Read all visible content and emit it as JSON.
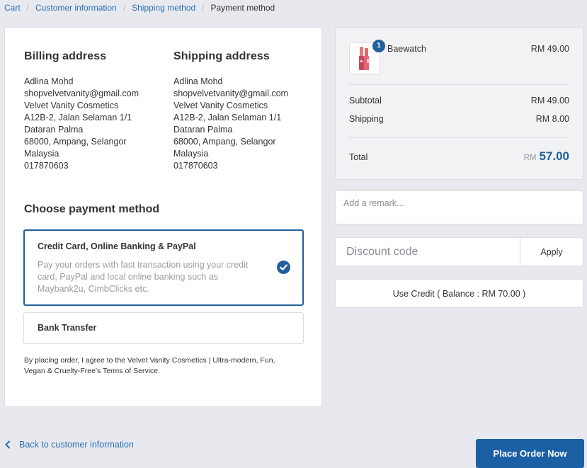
{
  "breadcrumb": {
    "items": [
      "Cart",
      "Customer information",
      "Shipping method"
    ],
    "current": "Payment method"
  },
  "billing": {
    "title": "Billing address",
    "lines": [
      "Adlina Mohd",
      "shopvelvetvanity@gmail.com",
      "Velvet Vanity Cosmetics",
      "A12B-2, Jalan Selaman 1/1",
      "Dataran Palma",
      "68000, Ampang, Selangor",
      "Malaysia",
      "017870603"
    ]
  },
  "shipping": {
    "title": "Shipping address",
    "lines": [
      "Adlina Mohd",
      "shopvelvetvanity@gmail.com",
      "Velvet Vanity Cosmetics",
      "A12B-2, Jalan Selaman 1/1",
      "Dataran Palma",
      "68000, Ampang, Selangor",
      "Malaysia",
      "017870603"
    ]
  },
  "payment": {
    "title": "Choose payment method",
    "options": [
      {
        "name": "Credit Card, Online Banking & PayPal",
        "description": "Pay your orders with fast transaction using your credit card, PayPal and local online banking such as Maybank2u, CimbClicks etc.",
        "selected": true
      },
      {
        "name": "Bank Transfer",
        "selected": false
      }
    ],
    "terms": "By placing order, I agree to the Velvet Vanity Cosmetics | Ultra-modern, Fun, Vegan & Cruelty-Free's Terms of Service."
  },
  "summary": {
    "product": {
      "name": "Baewatch",
      "price": "RM 49.00",
      "quantity": "1"
    },
    "subtotal_label": "Subtotal",
    "subtotal_value": "RM 49.00",
    "shipping_label": "Shipping",
    "shipping_value": "RM 8.00",
    "total_label": "Total",
    "total_currency": "RM",
    "total_amount": "57.00"
  },
  "remark": {
    "placeholder": "Add a remark..."
  },
  "discount": {
    "placeholder": "Discount code",
    "apply_label": "Apply"
  },
  "credit": {
    "label": "Use Credit ( Balance : RM 70.00 )"
  },
  "footer": {
    "back_label": "Back to customer information",
    "place_order_label": "Place Order Now"
  },
  "colors": {
    "accent": "#21609c",
    "link": "#2a6fb5",
    "background": "#e8e9ee",
    "primary_button": "#1b60a5"
  },
  "icons": {
    "check": "check-circle-icon",
    "back": "chevron-left-icon",
    "product": "lipstick-product-image"
  }
}
